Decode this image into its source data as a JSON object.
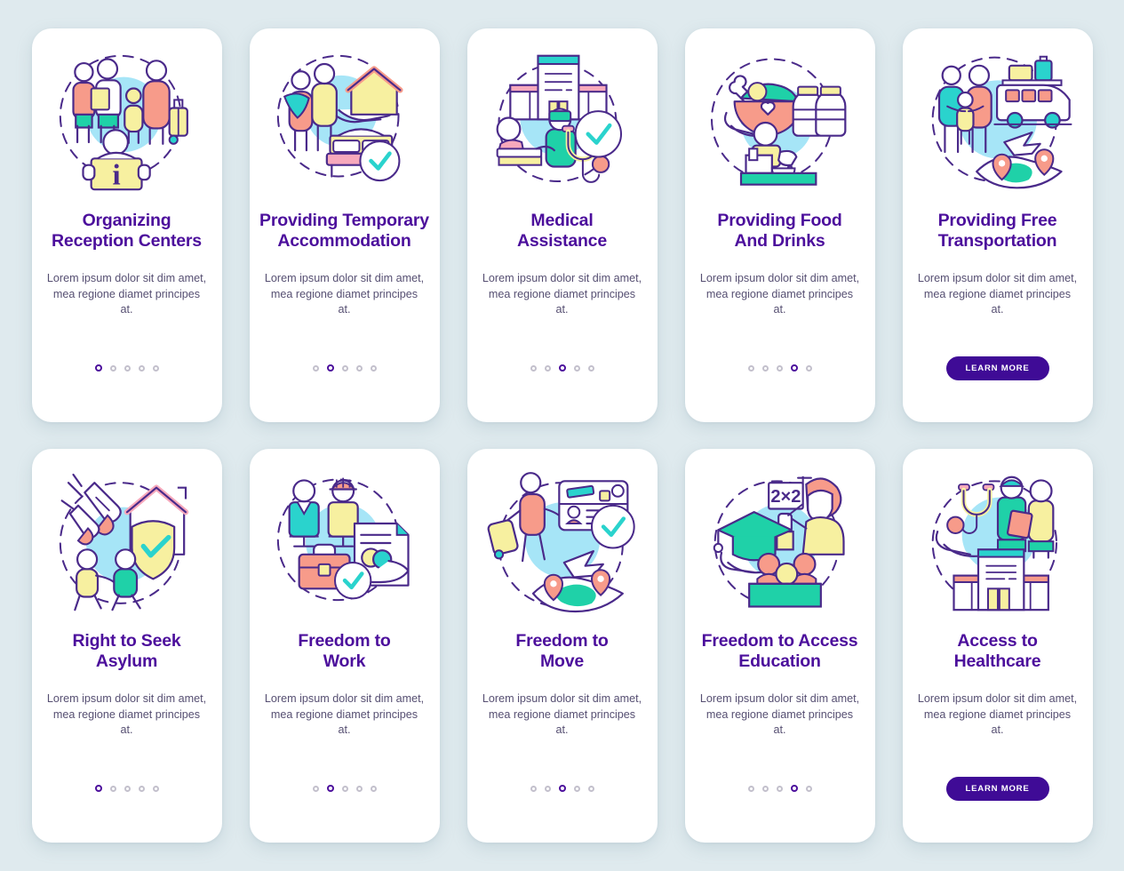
{
  "theme": {
    "background": "#dfeaee",
    "card_background": "#ffffff",
    "title_color": "#4c0f9c",
    "body_color": "#564f72",
    "accent_purple": "#3f0b96",
    "dot_inactive": "#c3c0cc",
    "illo_outline": "#4a2a8a",
    "illo_blue_blob": "#a6e5f7",
    "illo_salmon": "#f79b8a",
    "illo_mint": "#1fd1a8",
    "illo_teal": "#2ad3cd",
    "illo_yellow": "#f7f0a0",
    "illo_pink": "#f7a9bc"
  },
  "body_text": "Lorem ipsum dolor sit dim amet, mea regione diamet principes at.",
  "learn_more_label": "LEARN MORE",
  "cards": [
    {
      "id": "organizing-reception-centers",
      "title_line1": "Organizing",
      "title_line2": "Reception Centers",
      "body": "Lorem ipsum dolor sit dim amet, mea regione diamet principes at.",
      "footer_type": "dots",
      "dots_total": 5,
      "dots_active_index": 0,
      "illustration": "reception-center-family-info-desk-icon"
    },
    {
      "id": "providing-temporary-accommodation",
      "title_line1": "Providing Temporary",
      "title_line2": "Accommodation",
      "body": "Lorem ipsum dolor sit dim amet, mea regione diamet principes at.",
      "footer_type": "dots",
      "dots_total": 5,
      "dots_active_index": 1,
      "illustration": "family-house-hand-bed-check-icon"
    },
    {
      "id": "medical-assistance",
      "title_line1": "Medical",
      "title_line2": "Assistance",
      "body": "Lorem ipsum dolor sit dim amet, mea regione diamet principes at.",
      "footer_type": "dots",
      "dots_total": 5,
      "dots_active_index": 2,
      "illustration": "hospital-doctor-stethoscope-check-icon"
    },
    {
      "id": "providing-food-and-drinks",
      "title_line1": "Providing Food",
      "title_line2": "And Drinks",
      "body": "Lorem ipsum dolor sit dim amet, mea regione diamet principes at.",
      "footer_type": "dots",
      "dots_total": 5,
      "dots_active_index": 3,
      "illustration": "food-bowl-water-bottles-volunteer-icon"
    },
    {
      "id": "providing-free-transportation",
      "title_line1": "Providing Free",
      "title_line2": "Transportation",
      "body": "Lorem ipsum dolor sit dim amet, mea regione diamet principes at.",
      "footer_type": "button",
      "button_label": "LEARN MORE",
      "illustration": "family-van-plane-globe-pins-icon"
    },
    {
      "id": "right-to-seek-asylum",
      "title_line1": "Right to Seek",
      "title_line2": "Asylum",
      "body": "Lorem ipsum dolor sit dim amet, mea regione diamet principes at.",
      "footer_type": "dots",
      "dots_total": 5,
      "dots_active_index": 0,
      "illustration": "bombs-house-shield-running-people-icon"
    },
    {
      "id": "freedom-to-work",
      "title_line1": "Freedom to",
      "title_line2": "Work",
      "body": "Lorem ipsum dolor sit dim amet, mea regione diamet principes at.",
      "footer_type": "dots",
      "dots_total": 5,
      "dots_active_index": 1,
      "illustration": "workers-briefcase-contract-handshake-icon"
    },
    {
      "id": "freedom-to-move",
      "title_line1": "Freedom to",
      "title_line2": "Move",
      "body": "Lorem ipsum dolor sit dim amet, mea regione diamet principes at.",
      "footer_type": "dots",
      "dots_total": 5,
      "dots_active_index": 2,
      "illustration": "traveler-id-card-plane-globe-pins-icon"
    },
    {
      "id": "freedom-to-access-education",
      "title_line1": "Freedom to Access",
      "title_line2": "Education",
      "body": "Lorem ipsum dolor sit dim amet, mea regione diamet principes at.",
      "footer_type": "dots",
      "dots_total": 5,
      "dots_active_index": 3,
      "illustration": "graduation-cap-teacher-students-icon",
      "illustration_text": "2×2"
    },
    {
      "id": "access-to-healthcare",
      "title_line1": "Access to",
      "title_line2": "Healthcare",
      "body": "Lorem ipsum dolor sit dim amet, mea regione diamet principes at.",
      "footer_type": "button",
      "button_label": "LEARN MORE",
      "illustration": "stethoscope-doctor-patient-clinic-icon"
    }
  ]
}
